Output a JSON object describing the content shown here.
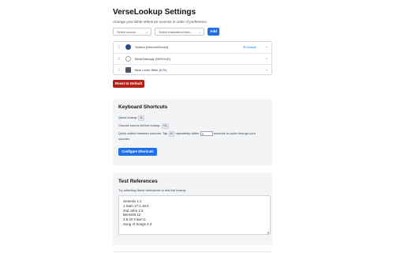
{
  "header": {
    "title": "VerseLookup Settings",
    "subtitle": "Arrange your Bible reference sources in order of preference."
  },
  "add_source": {
    "source_select": "Select source...",
    "translation_select": "Select translation/view...",
    "add_label": "Add"
  },
  "sources": [
    {
      "name": "Sefaria (Hebrew/Greek)",
      "default_label": "Default",
      "icon": "sefaria-icon",
      "color": "#2b4b8c"
    },
    {
      "name": "BibleGateway (NRSVUE)",
      "default_label": "",
      "icon": "biblegateway-icon",
      "color": "#9aa0a6"
    },
    {
      "name": "Blue Letter Bible (KJV)",
      "default_label": "",
      "icon": "blueletterbible-icon",
      "color": "#4b5563"
    }
  ],
  "reset_label": "Reset to Default",
  "keyboard": {
    "heading": "Keyboard Shortcuts",
    "quick_lookup_label": "Quick lookup:",
    "quick_lookup_key": "⌘L",
    "choose_source_label": "Choose source before lookup:",
    "choose_source_key": "⌥⌘L",
    "switch_prefix": "Quick switch between sources: Tap",
    "switch_key": "⌘L",
    "switch_middle": "repeatedly within",
    "switch_seconds": "3",
    "switch_suffix": "seconds to cycle through your",
    "switch_suffix2": "sources.",
    "configure_label": "Configure Shortcuts"
  },
  "test": {
    "heading": "Test References",
    "hint": "Try selecting these references to test the lookup:",
    "references": [
      "Genesis 1:1",
      "1 Sam 17:1-18:4",
      "2nd John 1:3",
      "Bereshit 12",
      "4:5-10 בראשית",
      "Song of Songs 2-3"
    ]
  },
  "colors": {
    "accent": "#1f6feb",
    "danger": "#b42318",
    "panel_bg": "#f3f4f6"
  }
}
